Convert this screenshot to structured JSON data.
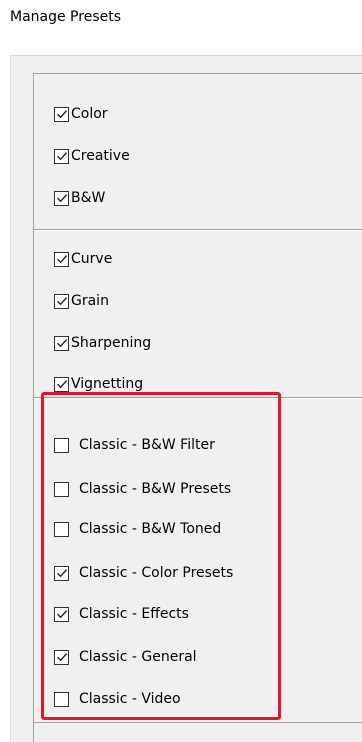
{
  "dialog": {
    "title": "Manage Presets"
  },
  "groups": [
    {
      "items": [
        {
          "label": "Color",
          "checked": true
        },
        {
          "label": "Creative",
          "checked": true
        },
        {
          "label": "B&W",
          "checked": true
        }
      ]
    },
    {
      "items": [
        {
          "label": "Curve",
          "checked": true
        },
        {
          "label": "Grain",
          "checked": true
        },
        {
          "label": "Sharpening",
          "checked": true
        },
        {
          "label": "Vignetting",
          "checked": true
        }
      ]
    },
    {
      "items": [
        {
          "label": "Classic - B&W Filter",
          "checked": false
        },
        {
          "label": "Classic - B&W Presets",
          "checked": false
        },
        {
          "label": "Classic - B&W Toned",
          "checked": false
        },
        {
          "label": "Classic - Color Presets",
          "checked": true
        },
        {
          "label": "Classic - Effects",
          "checked": true
        },
        {
          "label": "Classic - General",
          "checked": true
        },
        {
          "label": "Classic - Video",
          "checked": false
        }
      ]
    }
  ],
  "colors": {
    "highlight": "#e8132f",
    "panel": "#f0f0f0"
  }
}
